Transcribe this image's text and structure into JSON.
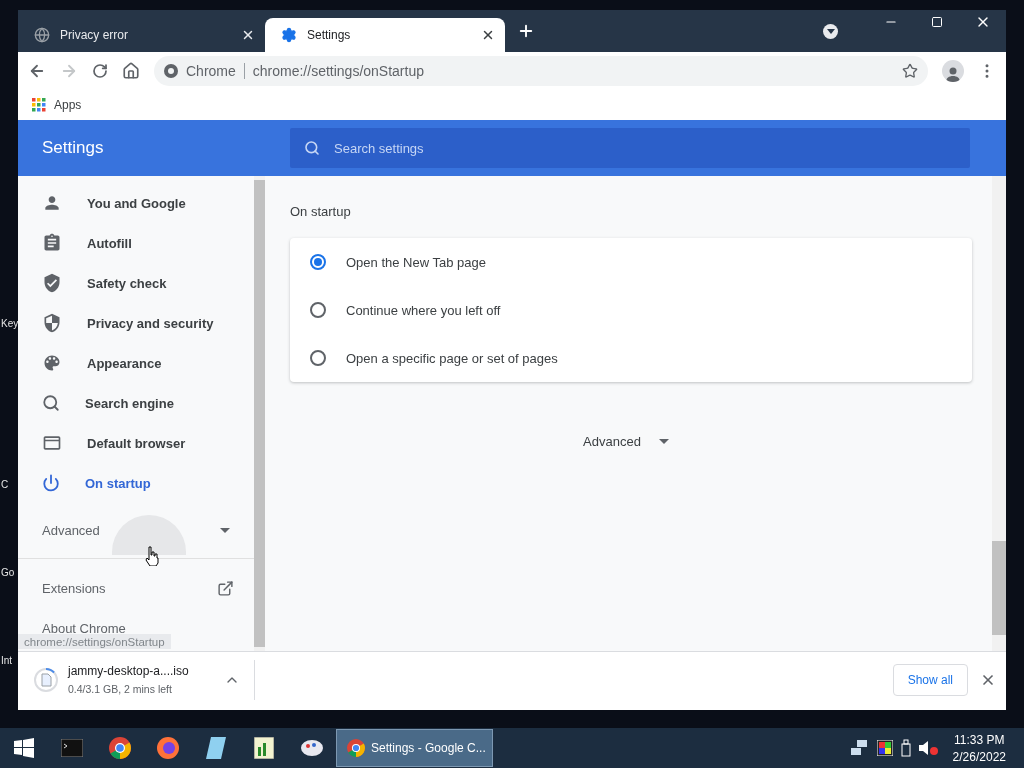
{
  "desktop": {
    "icon_labels": [
      "Key",
      "C",
      "Go",
      "Int"
    ]
  },
  "browser": {
    "tabs": [
      {
        "title": "Privacy error",
        "kind": "globe",
        "selected": false
      },
      {
        "title": "Settings",
        "kind": "gear",
        "selected": true
      }
    ],
    "address_bar": {
      "site_label": "Chrome",
      "url": "chrome://settings/onStartup"
    },
    "bookmarks": [
      {
        "label": "Apps"
      }
    ],
    "settings": {
      "title": "Settings",
      "search": {
        "placeholder": "Search settings"
      },
      "sidebar": {
        "items": [
          {
            "label": "You and Google",
            "kind": "person",
            "selected": false
          },
          {
            "label": "Autofill",
            "kind": "clipboard",
            "selected": false
          },
          {
            "label": "Safety check",
            "kind": "shield-check",
            "selected": false
          },
          {
            "label": "Privacy and security",
            "kind": "shield-half",
            "selected": false
          },
          {
            "label": "Appearance",
            "kind": "palette",
            "selected": false
          },
          {
            "label": "Search engine",
            "kind": "search",
            "selected": false
          },
          {
            "label": "Default browser",
            "kind": "browser",
            "selected": false
          },
          {
            "label": "On startup",
            "kind": "power",
            "selected": true
          }
        ],
        "advanced": "Advanced",
        "extensions": "Extensions",
        "about": "About Chrome"
      },
      "section_title": "On startup",
      "options": [
        {
          "label": "Open the New Tab page",
          "selected": true
        },
        {
          "label": "Continue where you left off",
          "selected": false
        },
        {
          "label": "Open a specific page or set of pages",
          "selected": false
        }
      ],
      "advanced_button": "Advanced"
    },
    "status_tooltip": "chrome://settings/onStartup",
    "download": {
      "filename": "jammy-desktop-a....iso",
      "progress": "0.4/3.1 GB, 2 mins left",
      "level": 0.13,
      "show_all": "Show all"
    }
  },
  "taskbar": {
    "active_window": "Settings - Google C...",
    "time": "11:33 PM",
    "date": "2/26/2022"
  }
}
